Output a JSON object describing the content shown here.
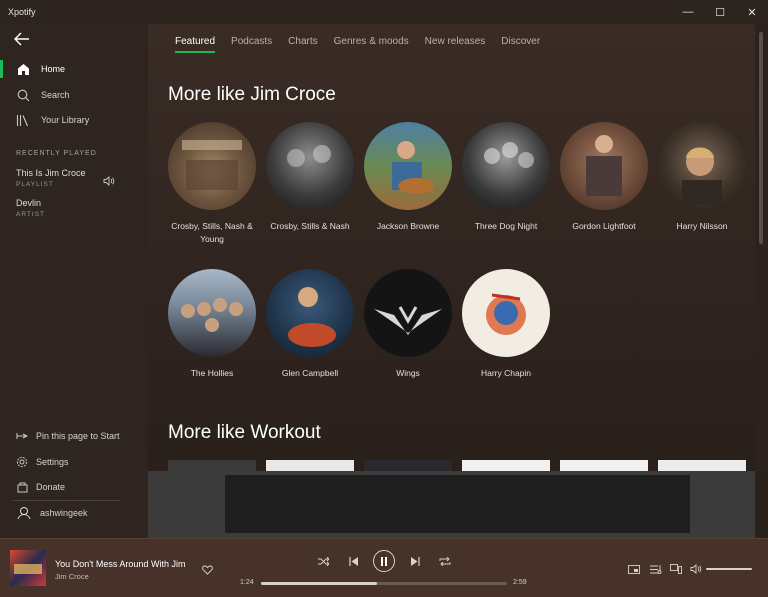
{
  "app": {
    "title": "Xpotify"
  },
  "window": {
    "minimize": "—",
    "maximize": "☐",
    "close": "✕"
  },
  "sidebar": {
    "nav": [
      {
        "label": "Home",
        "icon": "home-icon"
      },
      {
        "label": "Search",
        "icon": "search-icon"
      },
      {
        "label": "Your Library",
        "icon": "library-icon"
      }
    ],
    "recently_played_label": "RECENTLY PLAYED",
    "recent": [
      {
        "name": "This Is Jim Croce",
        "type": "PLAYLIST"
      },
      {
        "name": "Devlin",
        "type": "ARTIST"
      }
    ],
    "bottom": [
      {
        "label": "Pin this page to Start",
        "icon": "pin-icon"
      },
      {
        "label": "Settings",
        "icon": "gear-icon"
      },
      {
        "label": "Donate",
        "icon": "donate-icon"
      },
      {
        "label": "ashwingeek",
        "icon": "user-icon"
      }
    ]
  },
  "main": {
    "tabs": [
      "Featured",
      "Podcasts",
      "Charts",
      "Genres & moods",
      "New releases",
      "Discover"
    ],
    "active_tab": 0,
    "sections": [
      {
        "title": "More like Jim Croce",
        "artists": [
          "Crosby, Stills, Nash & Young",
          "Crosby, Stills & Nash",
          "Jackson Browne",
          "Three Dog Night",
          "Gordon Lightfoot",
          "Harry Nilsson",
          "The Hollies",
          "Glen Campbell",
          "Wings",
          "Harry Chapin"
        ]
      },
      {
        "title": "More like Workout"
      }
    ]
  },
  "player": {
    "track_title": "You Don't Mess Around With Jim",
    "track_artist": "Jim Croce",
    "elapsed": "1:24",
    "duration": "2:59",
    "progress": 0.47,
    "volume": 1.0
  },
  "colors": {
    "accent": "#1db954",
    "player_bg": "#473229",
    "sidebar_bg": "#2e2520"
  }
}
